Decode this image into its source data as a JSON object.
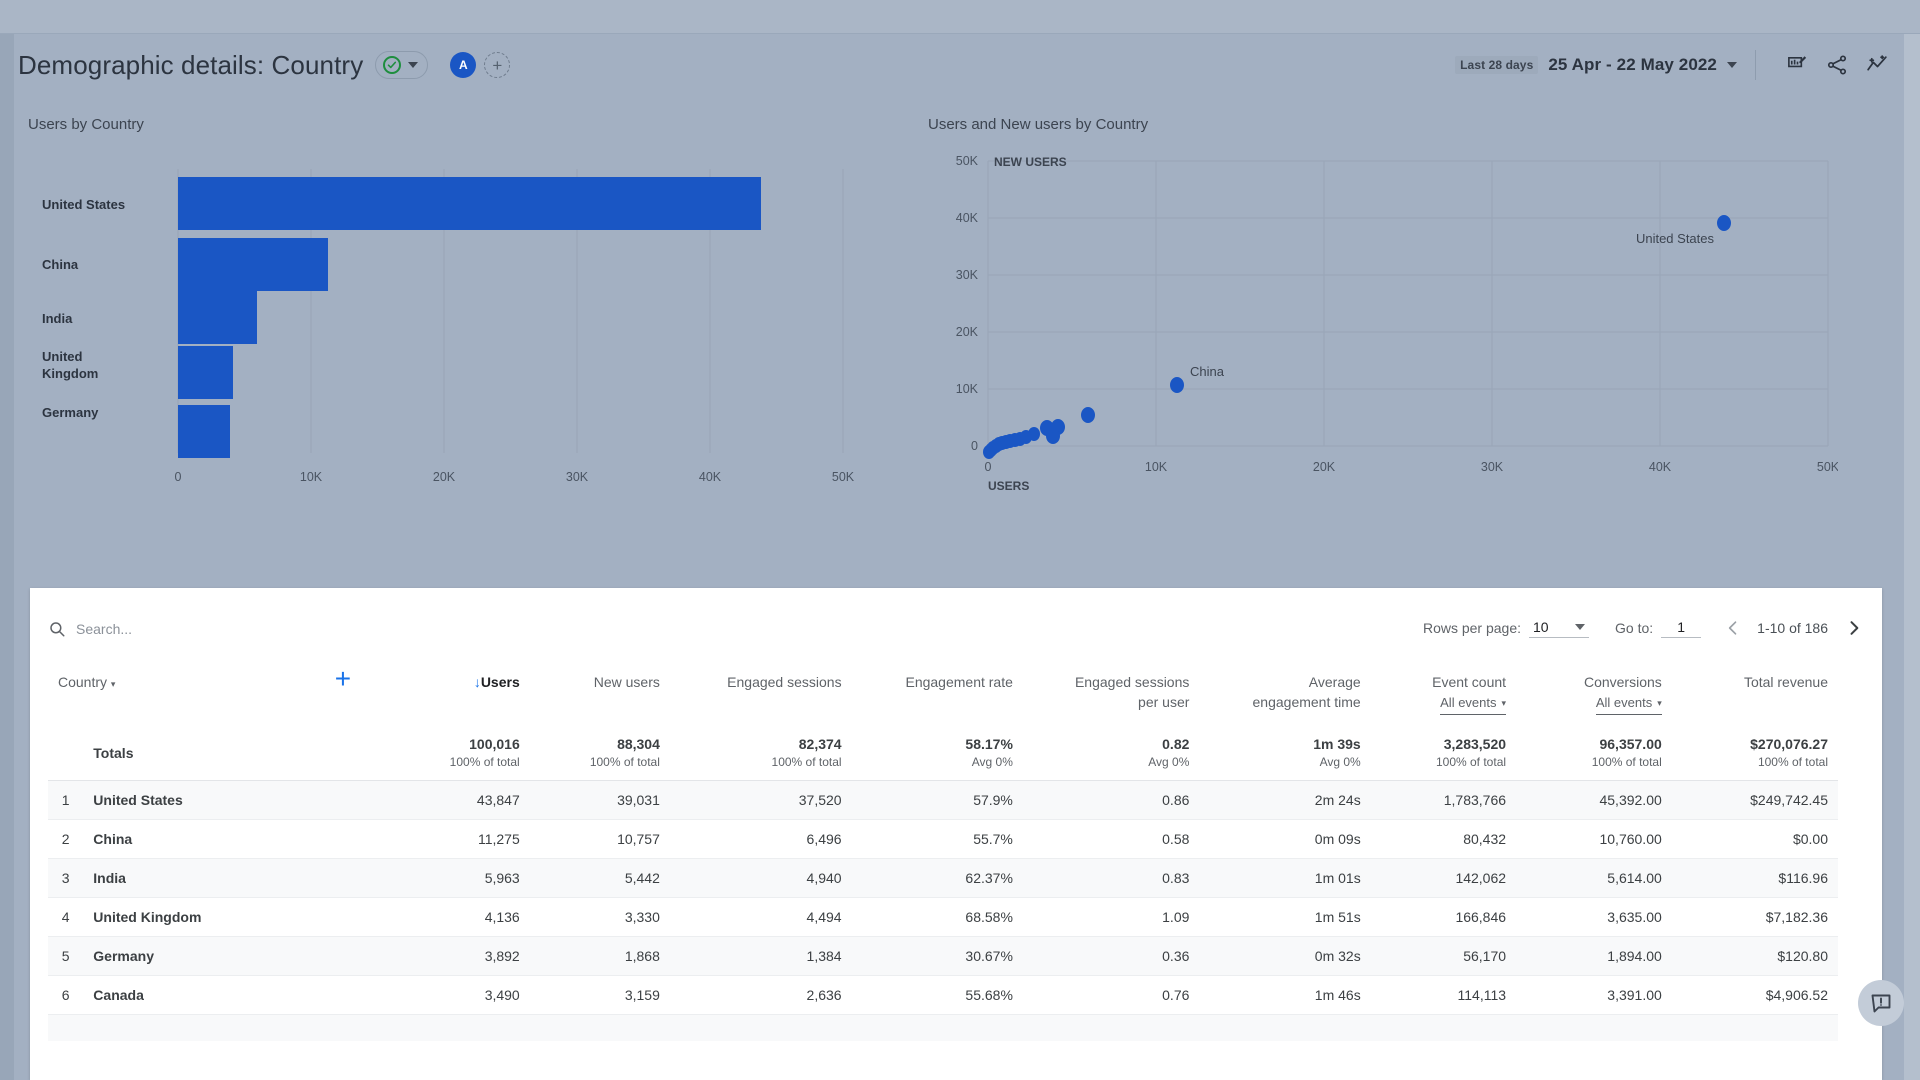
{
  "header": {
    "title": "Demographic details: Country",
    "status_icon": "check-circle-icon",
    "account_initial": "A",
    "add_label": "+",
    "date_badge": "Last 28 days",
    "date_range": "25 Apr - 22 May 2022",
    "icons": [
      "edit-chart-icon",
      "share-icon",
      "insights-icon"
    ]
  },
  "charts": {
    "bar": {
      "title": "Users by Country"
    },
    "scatter": {
      "title": "Users and New users by Country"
    }
  },
  "chart_data": [
    {
      "type": "bar",
      "title": "Users by Country",
      "orientation": "horizontal",
      "categories": [
        "United States",
        "China",
        "India",
        "United Kingdom",
        "Germany"
      ],
      "values": [
        43847,
        11275,
        5963,
        4136,
        3892
      ],
      "xlabel": "",
      "ylabel": "",
      "xlim": [
        0,
        50000
      ],
      "xticks": [
        "0",
        "10K",
        "20K",
        "30K",
        "40K",
        "50K"
      ],
      "xtick_values": [
        0,
        10000,
        20000,
        30000,
        40000,
        50000
      ],
      "grid": true,
      "legend": "none",
      "color": "#1a56c4"
    },
    {
      "type": "scatter",
      "title": "Users and New users by Country",
      "xlabel": "USERS",
      "ylabel": "NEW USERS",
      "xlim": [
        0,
        50000
      ],
      "ylim": [
        0,
        50000
      ],
      "xticks": [
        "0",
        "10K",
        "20K",
        "30K",
        "40K",
        "50K"
      ],
      "yticks": [
        "0",
        "10K",
        "20K",
        "30K",
        "40K",
        "50K"
      ],
      "xtick_values": [
        0,
        10000,
        20000,
        30000,
        40000,
        50000
      ],
      "ytick_values": [
        0,
        10000,
        20000,
        30000,
        40000,
        50000
      ],
      "grid": true,
      "legend": "none",
      "color": "#1a56c4",
      "points": [
        {
          "label": "United States",
          "x": 43847,
          "y": 39031
        },
        {
          "label": "China",
          "x": 11275,
          "y": 10757
        },
        {
          "label": "",
          "x": 5963,
          "y": 5442
        },
        {
          "label": "",
          "x": 4136,
          "y": 3330
        },
        {
          "label": "",
          "x": 3892,
          "y": 1868
        },
        {
          "label": "",
          "x": 3490,
          "y": 3159
        },
        {
          "label": "",
          "x": 2400,
          "y": 2100
        },
        {
          "label": "",
          "x": 2000,
          "y": 1750
        },
        {
          "label": "",
          "x": 1700,
          "y": 1500
        },
        {
          "label": "",
          "x": 1400,
          "y": 1250
        },
        {
          "label": "",
          "x": 1100,
          "y": 950
        },
        {
          "label": "",
          "x": 900,
          "y": 800
        },
        {
          "label": "",
          "x": 700,
          "y": 620
        },
        {
          "label": "",
          "x": 520,
          "y": 460
        },
        {
          "label": "",
          "x": 380,
          "y": 330
        },
        {
          "label": "",
          "x": 260,
          "y": 220
        },
        {
          "label": "",
          "x": 150,
          "y": 130
        },
        {
          "label": "",
          "x": 80,
          "y": 60
        }
      ]
    }
  ],
  "table_toolbar": {
    "search_placeholder": "Search...",
    "search_value": "",
    "rows_per_page_label": "Rows per page:",
    "rows_per_page_value": "10",
    "goto_label": "Go to:",
    "goto_value": "1",
    "range_text": "1-10 of 186"
  },
  "table": {
    "dimension_header": "Country",
    "add_column_label": "+",
    "columns": [
      {
        "label": "Users",
        "sorted": true,
        "sort_dir": "desc"
      },
      {
        "label": "New users"
      },
      {
        "label": "Engaged sessions"
      },
      {
        "label": "Engagement rate"
      },
      {
        "label": "Engaged sessions",
        "label2": "per user"
      },
      {
        "label": "Average",
        "label2": "engagement time"
      },
      {
        "label": "Event count",
        "dropdown": "All events"
      },
      {
        "label": "Conversions",
        "dropdown": "All events"
      },
      {
        "label": "Total revenue"
      }
    ],
    "totals": {
      "label": "Totals",
      "values": [
        "100,016",
        "88,304",
        "82,374",
        "58.17%",
        "0.82",
        "1m 39s",
        "3,283,520",
        "96,357.00",
        "$270,076.27"
      ],
      "subs": [
        "100% of total",
        "100% of total",
        "100% of total",
        "Avg 0%",
        "Avg 0%",
        "Avg 0%",
        "100% of total",
        "100% of total",
        "100% of total"
      ]
    },
    "rows": [
      {
        "index": "1",
        "country": "United States",
        "values": [
          "43,847",
          "39,031",
          "37,520",
          "57.9%",
          "0.86",
          "2m 24s",
          "1,783,766",
          "45,392.00",
          "$249,742.45"
        ]
      },
      {
        "index": "2",
        "country": "China",
        "values": [
          "11,275",
          "10,757",
          "6,496",
          "55.7%",
          "0.58",
          "0m 09s",
          "80,432",
          "10,760.00",
          "$0.00"
        ]
      },
      {
        "index": "3",
        "country": "India",
        "values": [
          "5,963",
          "5,442",
          "4,940",
          "62.37%",
          "0.83",
          "1m 01s",
          "142,062",
          "5,614.00",
          "$116.96"
        ]
      },
      {
        "index": "4",
        "country": "United Kingdom",
        "values": [
          "4,136",
          "3,330",
          "4,494",
          "68.58%",
          "1.09",
          "1m 51s",
          "166,846",
          "3,635.00",
          "$7,182.36"
        ]
      },
      {
        "index": "5",
        "country": "Germany",
        "values": [
          "3,892",
          "1,868",
          "1,384",
          "30.67%",
          "0.36",
          "0m 32s",
          "56,170",
          "1,894.00",
          "$120.80"
        ]
      },
      {
        "index": "6",
        "country": "Canada",
        "values": [
          "3,490",
          "3,159",
          "2,636",
          "55.68%",
          "0.76",
          "1m 46s",
          "114,113",
          "3,391.00",
          "$4,906.52"
        ]
      }
    ]
  },
  "feedback": {
    "icon": "feedback-icon"
  },
  "colors": {
    "accent": "#1a73e8",
    "bar": "#1a56c4",
    "ok": "#1e8e3e"
  }
}
